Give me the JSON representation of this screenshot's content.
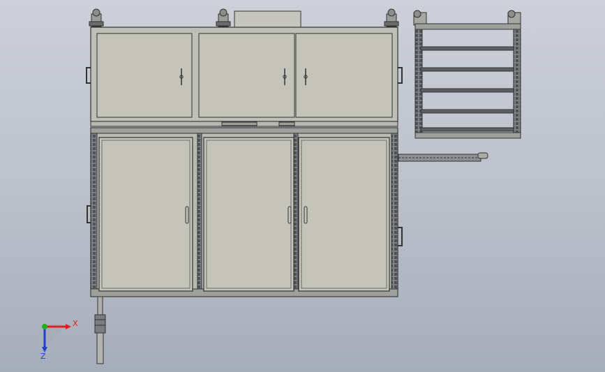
{
  "viewport": {
    "background_top": "#c9ccd5",
    "background_bottom": "#a8aebb"
  },
  "colors": {
    "panel_fill": "#c4c4bb",
    "frame_fill": "#b9bab3",
    "outline": "#3a3a3a",
    "profile_dark": "#555a5e",
    "axis_x": "#e02020",
    "axis_y": "#20b020",
    "axis_z": "#2040d0"
  },
  "model": {
    "name": "cabinet-assembly-front-view",
    "upper_cabinet_doors": 3,
    "lower_cabinet_doors": 3,
    "side_rack_shelves": 6
  },
  "triad": {
    "x_label": "X",
    "z_label": "Z",
    "icons": [
      "x-axis-arrow-icon",
      "y-axis-dot-icon",
      "z-axis-arrow-icon"
    ]
  }
}
